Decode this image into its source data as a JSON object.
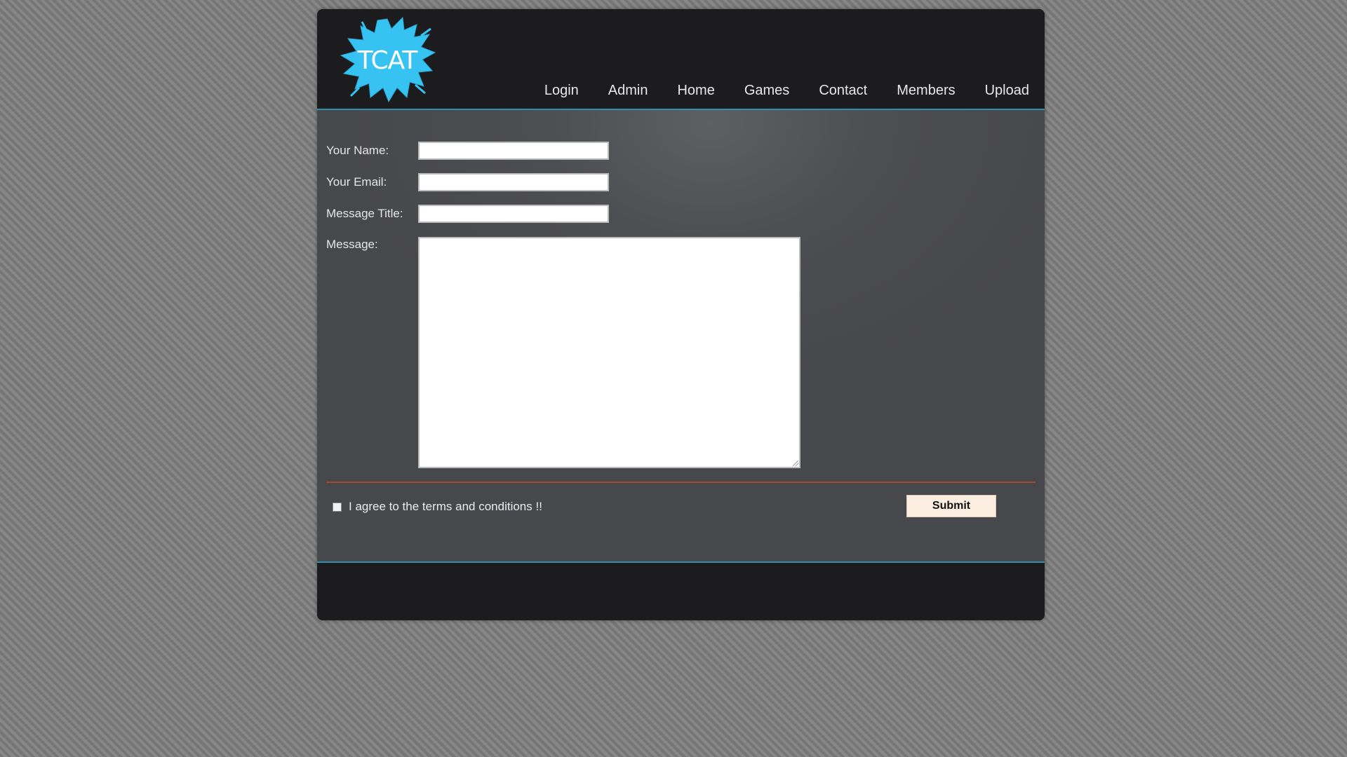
{
  "logo": {
    "text": "TCAT",
    "color": "#36c3f2"
  },
  "nav": {
    "items": [
      {
        "label": "Login"
      },
      {
        "label": "Admin"
      },
      {
        "label": "Home"
      },
      {
        "label": "Games"
      },
      {
        "label": "Contact"
      },
      {
        "label": "Members"
      },
      {
        "label": "Upload"
      }
    ]
  },
  "form": {
    "name_label": "Your Name:",
    "name_value": "",
    "email_label": "Your Email:",
    "email_value": "",
    "title_label": "Message Title:",
    "title_value": "",
    "message_label": "Message:",
    "message_value": "",
    "agree_label": "I agree to the terms and conditions !!",
    "agree_checked": false,
    "submit_label": "Submit"
  },
  "colors": {
    "accent_line": "#2f8fae",
    "divider": "#a3492f",
    "header_bg": "#1c1c1e",
    "content_bg": "#4d4e52",
    "submit_bg": "#fbeee0"
  }
}
